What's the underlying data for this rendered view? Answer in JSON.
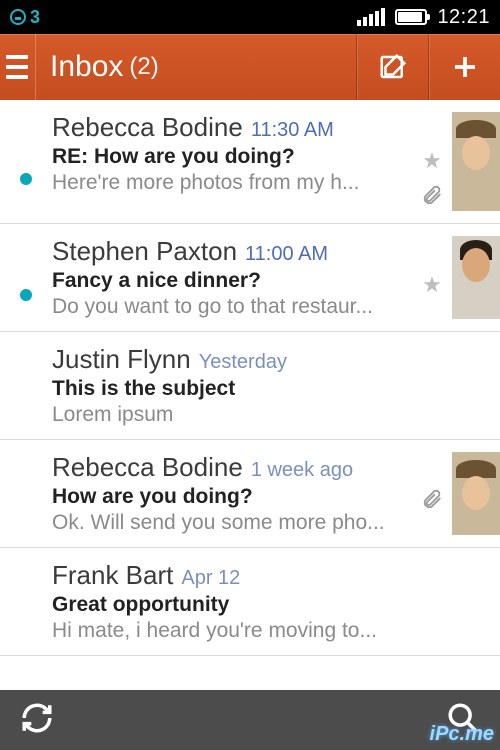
{
  "status": {
    "notif_count": "3",
    "time": "12:21"
  },
  "header": {
    "title": "Inbox",
    "unread_count": "(2)"
  },
  "messages": [
    {
      "sender": "Rebecca Bodine",
      "time": "11:30 AM",
      "subject": "RE: How are you doing?",
      "preview": "Here're more photos from my h...",
      "unread": true,
      "starred": true,
      "attachment": true,
      "avatar": "female-hat"
    },
    {
      "sender": "Stephen Paxton",
      "time": "11:00 AM",
      "subject": "Fancy a nice dinner?",
      "preview": "Do you want to go to that restaur...",
      "unread": true,
      "starred": true,
      "attachment": false,
      "avatar": "male"
    },
    {
      "sender": "Justin Flynn",
      "time": "Yesterday",
      "subject": "This is the subject",
      "preview": "Lorem ipsum",
      "unread": false,
      "starred": false,
      "attachment": false,
      "avatar": null
    },
    {
      "sender": "Rebecca Bodine",
      "time": "1 week ago",
      "subject": "How are you doing?",
      "preview": "Ok. Will send you some more pho...",
      "unread": false,
      "starred": false,
      "attachment": true,
      "avatar": "female-hat"
    },
    {
      "sender": "Frank Bart",
      "time": "Apr 12",
      "subject": "Great opportunity",
      "preview": "Hi mate, i heard you're moving to...",
      "unread": false,
      "starred": false,
      "attachment": false,
      "avatar": null
    }
  ],
  "watermark": "iPc.me"
}
